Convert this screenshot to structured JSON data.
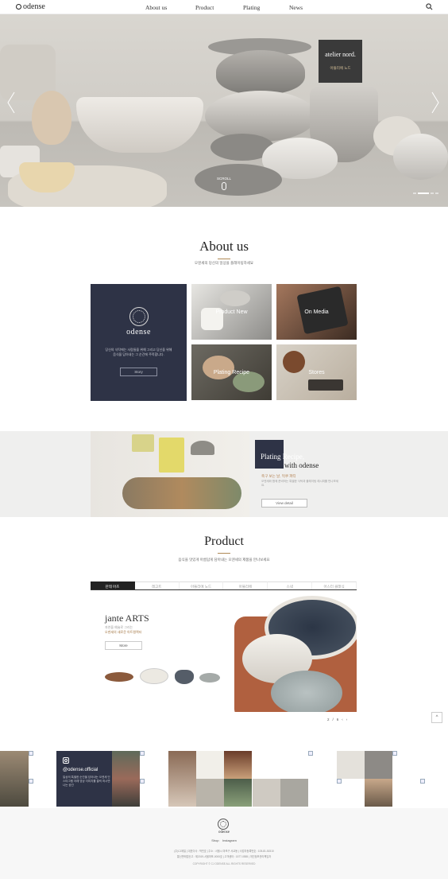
{
  "header": {
    "logo": "odense",
    "nav": [
      "About us",
      "Product",
      "Plating",
      "News"
    ],
    "search_icon": "search-icon"
  },
  "hero": {
    "card_title": "atelier nord.",
    "card_sub": "아뜰리에 노드",
    "scroll_label": "SCROLL"
  },
  "about": {
    "title": "About us",
    "subtitle": "오덴세의 당신의 일상을 플레이팅하세요",
    "brand_name": "odense",
    "brand_desc": "당신의 식탁에는 사람들을 위해 그리고 당신을 위해 음식을 담아내는 그 순간에 주목합니다.",
    "story_button": "Story",
    "tiles": [
      "Product New",
      "On Media",
      "Plating Recipe",
      "Stores"
    ]
  },
  "recipe": {
    "title_line1": "Plating Recipe,",
    "title_line2": "with odense",
    "sub": "축구 보는 날, 먹쿠 파티",
    "desc": "오덴세와 함께 준비하는 특별한 식탁과 플레이팅 레시피를 만나보세요.",
    "button": "View detail"
  },
  "product": {
    "title": "Product",
    "subtitle": "음식을 맛있게 아름답게 담아내는 오덴세의 제품을 만나보세요",
    "tabs": [
      "잔테 아츠",
      "레고트",
      "아뜰리에 노드",
      "아뜰리에",
      "스낵",
      "어스터 클래식"
    ],
    "active_tab": 0,
    "featured_name": "jante ARTS",
    "featured_sub1": "자연을 예술로 그리는",
    "featured_sub2": "오덴세의 새로운 아트컬렉터",
    "more_button": "More",
    "pager": {
      "current": "2",
      "sep": "/",
      "total": "6"
    },
    "top_button": "^"
  },
  "instagram": {
    "handle": "@odense.official",
    "desc": "일상의 특별한 순간을 담아내는 오덴세 인스타그램 아래 영상 이미지를 클릭 하시면 나는 공간"
  },
  "footer": {
    "brand": "odense",
    "links": [
      "Shop",
      "Instagram"
    ],
    "info_line1": "(주)CJ제일 | 대표이사 : 박민호 | 주소 : 서울시 마포구 서교동 | 사업자등록번호 : 105-81-51510",
    "info_line2": "통신판매업신고 : 제2019-서울마포-0000호 | 고객센터 : 1577-0555 | 개인정보관리책임자",
    "copyright": "COPYRIGHT © CJ ODENSE ALL RIGHTS RESERVED"
  },
  "colors": {
    "navy": "#2e3346",
    "accent": "#b08a56",
    "band": "#efefee"
  }
}
